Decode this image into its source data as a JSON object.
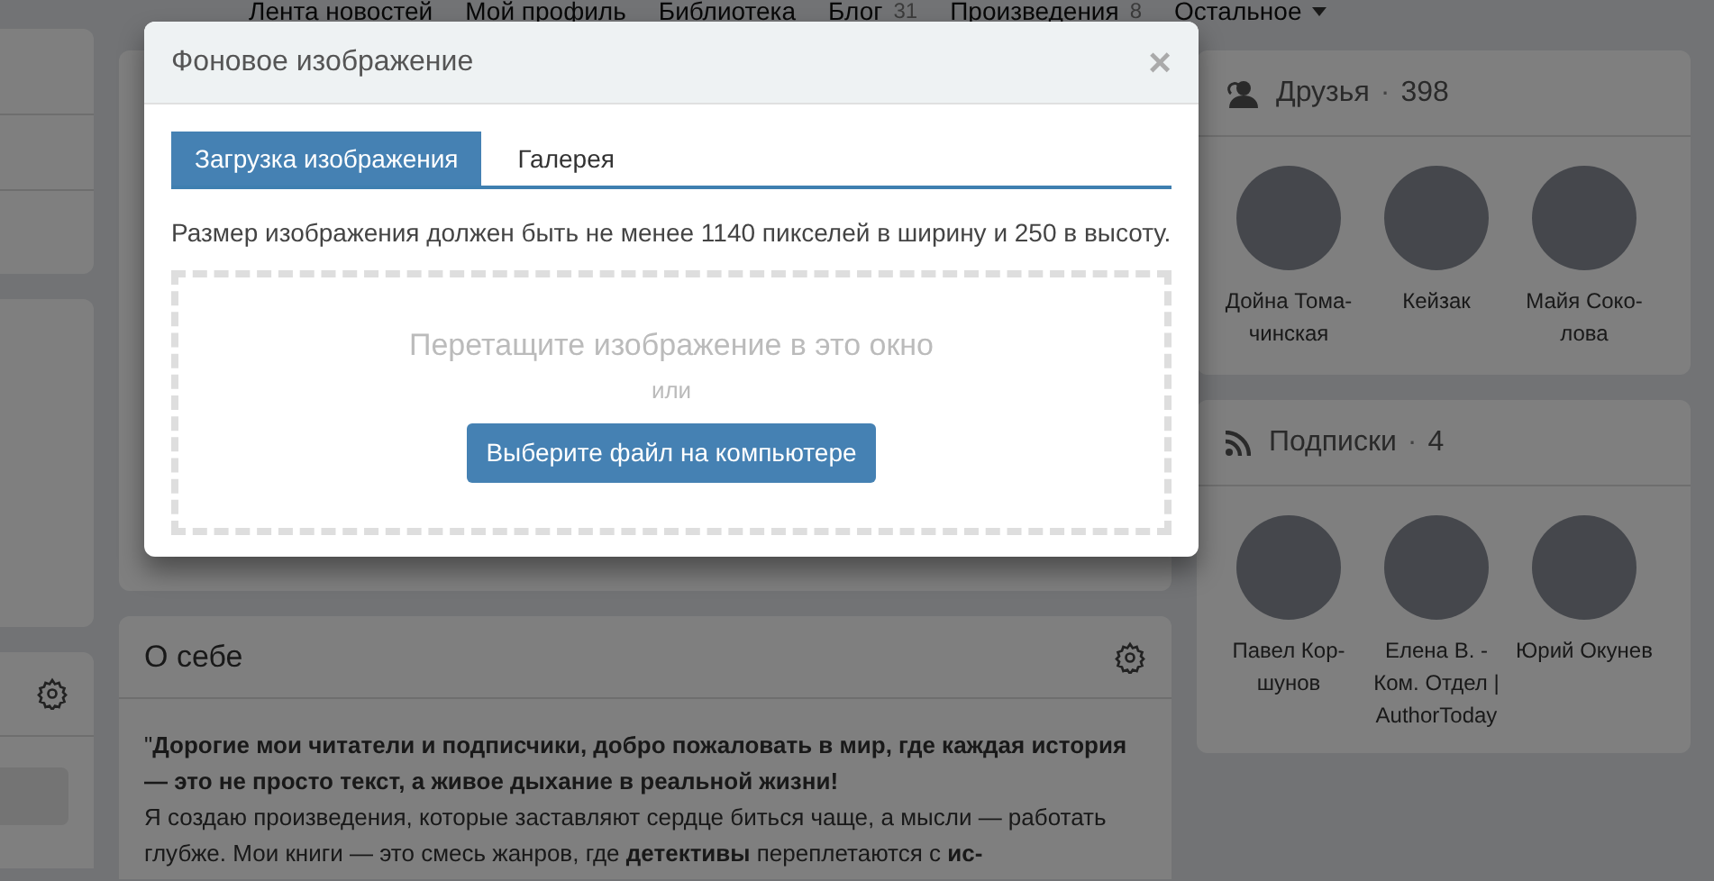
{
  "nav": [
    {
      "label": "Лента новостей"
    },
    {
      "label": "Мой профиль"
    },
    {
      "label": "Библиотека"
    },
    {
      "label": "Блог",
      "count": "31"
    },
    {
      "label": "Произведения",
      "count": "8"
    },
    {
      "label": "Остальное",
      "dropdown": true
    }
  ],
  "about": {
    "title": "О себе",
    "paragraphs": [
      "\"**Дорогие мои читатели и подписчики, добро пожаловать в мир, где каждая история — это не просто текст, а живое дыхание в реальной жизни!**",
      "Я создаю произведения, которые заставляют сердце биться чаще, а мысли — работать глубже. Мои книги — это смесь жанров, где **детективы** переплетаются с **ис-**"
    ]
  },
  "friends": {
    "title": "Друзья",
    "separator": "·",
    "count": "398",
    "people": [
      {
        "name": "Дойна Тома-чинская"
      },
      {
        "name": "Кейзак"
      },
      {
        "name": "Майя Соко-лова"
      }
    ]
  },
  "subscriptions": {
    "title": "Подписки",
    "separator": "·",
    "count": "4",
    "people": [
      {
        "name": "Павел Кор-шунов"
      },
      {
        "name": "Елена В. - Ком. Отдел | AuthorToday"
      },
      {
        "name": "Юрий Окунев"
      }
    ]
  },
  "modal": {
    "title": "Фоновое изображение",
    "close": "×",
    "tabs": [
      {
        "label": "Загрузка изображения",
        "selected": true
      },
      {
        "label": "Галерея",
        "selected": false
      }
    ],
    "hint": "Размер изображения должен быть не менее 1140 пикселей в ширину и 250 в высоту.",
    "drop_text": "Перетащите изображение в это окно",
    "or": "или",
    "button": "Выберите файл на компьютере"
  }
}
